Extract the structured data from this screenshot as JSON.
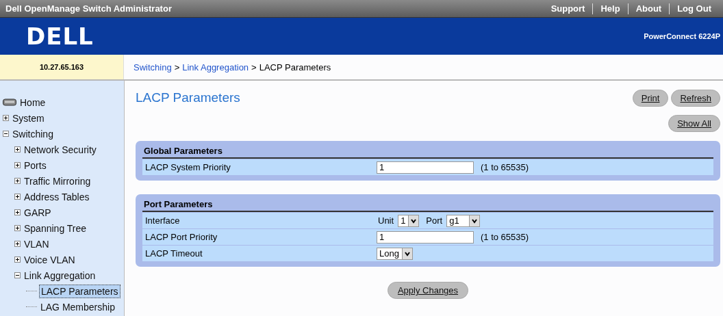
{
  "top_bar": {
    "title": "Dell OpenManage Switch Administrator",
    "links": [
      "Support",
      "Help",
      "About",
      "Log Out"
    ]
  },
  "header": {
    "logo": "DELL",
    "model": "PowerConnect 6224P"
  },
  "address": "10.27.65.163",
  "breadcrumb": {
    "links": [
      "Switching",
      "Link Aggregation"
    ],
    "separator": ">",
    "current": "LACP Parameters"
  },
  "sidebar": {
    "items": [
      {
        "label": "Home",
        "selected": false
      },
      {
        "label": "System",
        "expanded": false,
        "selected": false
      },
      {
        "label": "Switching",
        "expanded": true,
        "selected": false,
        "children": [
          {
            "label": "Network Security",
            "expanded": false,
            "selected": false
          },
          {
            "label": "Ports",
            "expanded": false,
            "selected": false
          },
          {
            "label": "Traffic Mirroring",
            "expanded": false,
            "selected": false
          },
          {
            "label": "Address Tables",
            "expanded": false,
            "selected": false
          },
          {
            "label": "GARP",
            "expanded": false,
            "selected": false
          },
          {
            "label": "Spanning Tree",
            "expanded": false,
            "selected": false
          },
          {
            "label": "VLAN",
            "expanded": false,
            "selected": false
          },
          {
            "label": "Voice VLAN",
            "expanded": false,
            "selected": false
          },
          {
            "label": "Link Aggregation",
            "expanded": true,
            "selected": false,
            "children": [
              {
                "label": "LACP Parameters",
                "selected": true
              },
              {
                "label": "LAG Membership",
                "selected": false
              }
            ]
          }
        ]
      }
    ]
  },
  "page": {
    "title": "LACP Parameters",
    "buttons": [
      "Print",
      "Refresh"
    ],
    "show_all": "Show All"
  },
  "panels": [
    {
      "title": "Global Parameters",
      "rows": [
        {
          "kind": "input",
          "label": "LACP System Priority",
          "value": "1",
          "hint": "(1 to 65535)"
        }
      ]
    },
    {
      "title": "Port Parameters",
      "rows": [
        {
          "kind": "interface",
          "label": "Interface",
          "unit_label": "Unit",
          "unit": "1",
          "port_label": "Port",
          "port": "g1"
        },
        {
          "kind": "input",
          "label": "LACP Port Priority",
          "value": "1",
          "hint": "(1 to 65535)"
        },
        {
          "kind": "select",
          "label": "LACP Timeout",
          "value": "Long"
        }
      ]
    }
  ],
  "apply_button": "Apply Changes"
}
